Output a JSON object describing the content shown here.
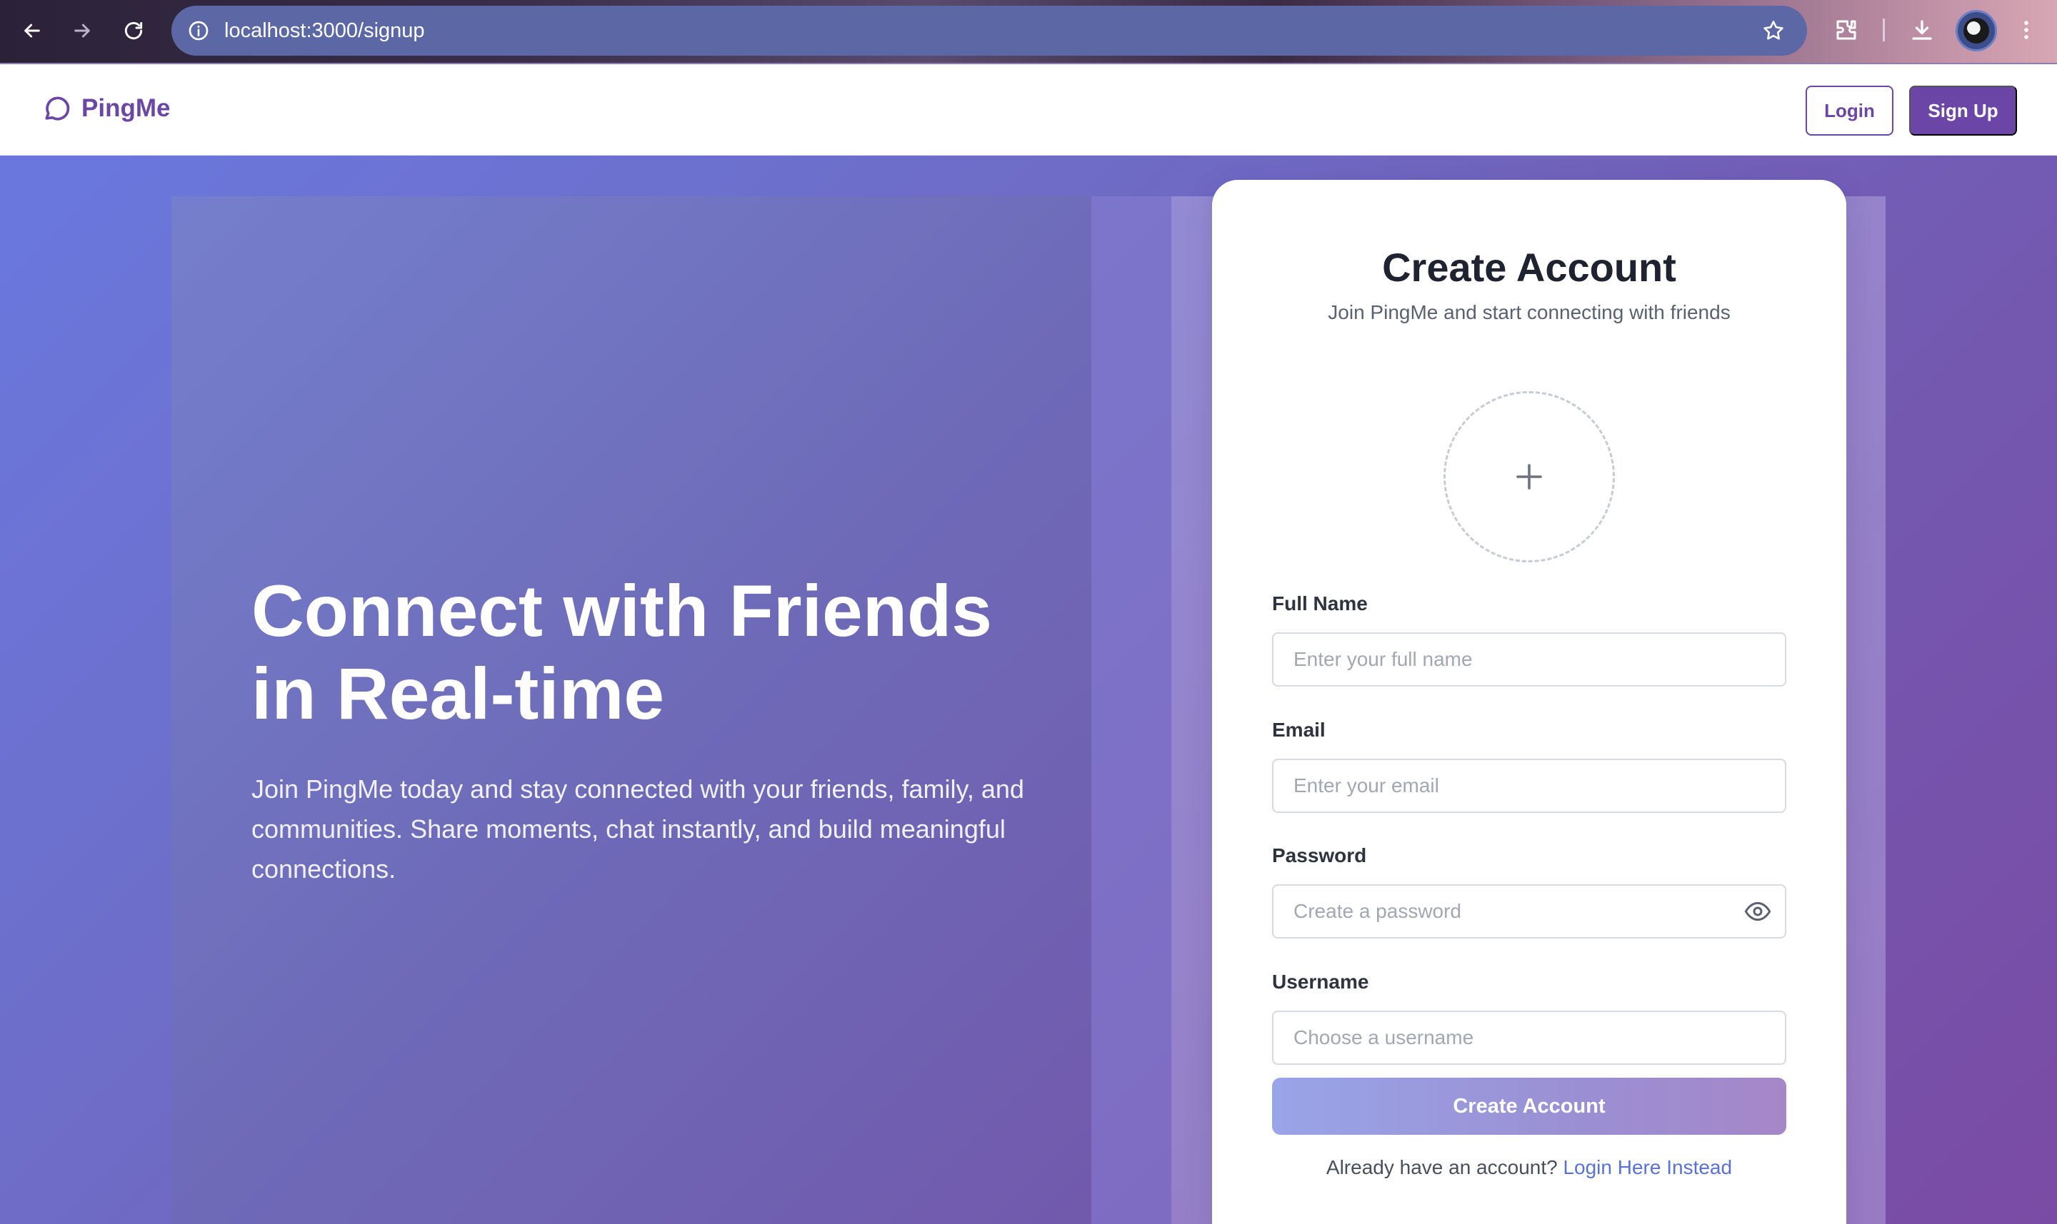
{
  "browser": {
    "url": "localhost:3000/signup",
    "icons": [
      "back-arrow-icon",
      "forward-arrow-icon",
      "reload-icon",
      "site-info-icon",
      "bookmark-star-icon",
      "extensions-icon",
      "download-icon",
      "profile-avatar",
      "menu-dots-icon"
    ]
  },
  "header": {
    "brand": "PingMe",
    "login_label": "Login",
    "signup_label": "Sign Up"
  },
  "hero": {
    "title": "Connect with Friends in Real-time",
    "text": "Join PingMe today and stay connected with your friends, family, and communities. Share moments, chat instantly, and build meaningful connections."
  },
  "signup": {
    "title": "Create Account",
    "subtitle": "Join PingMe and start connecting with friends",
    "full_name": {
      "label": "Full Name",
      "placeholder": "Enter your full name",
      "value": ""
    },
    "email": {
      "label": "Email",
      "placeholder": "Enter your email",
      "value": ""
    },
    "password": {
      "label": "Password",
      "placeholder": "Create a password",
      "value": ""
    },
    "username": {
      "label": "Username",
      "placeholder": "Choose a username",
      "value": ""
    },
    "submit_label": "Create Account",
    "login_prompt": "Already have an account?",
    "login_link": "Login Here Instead"
  },
  "colors": {
    "brand": "#6b46a6",
    "link": "#5872d9",
    "hero_gradient_start": "#6a78de",
    "hero_gradient_end": "#7a4ba4"
  }
}
